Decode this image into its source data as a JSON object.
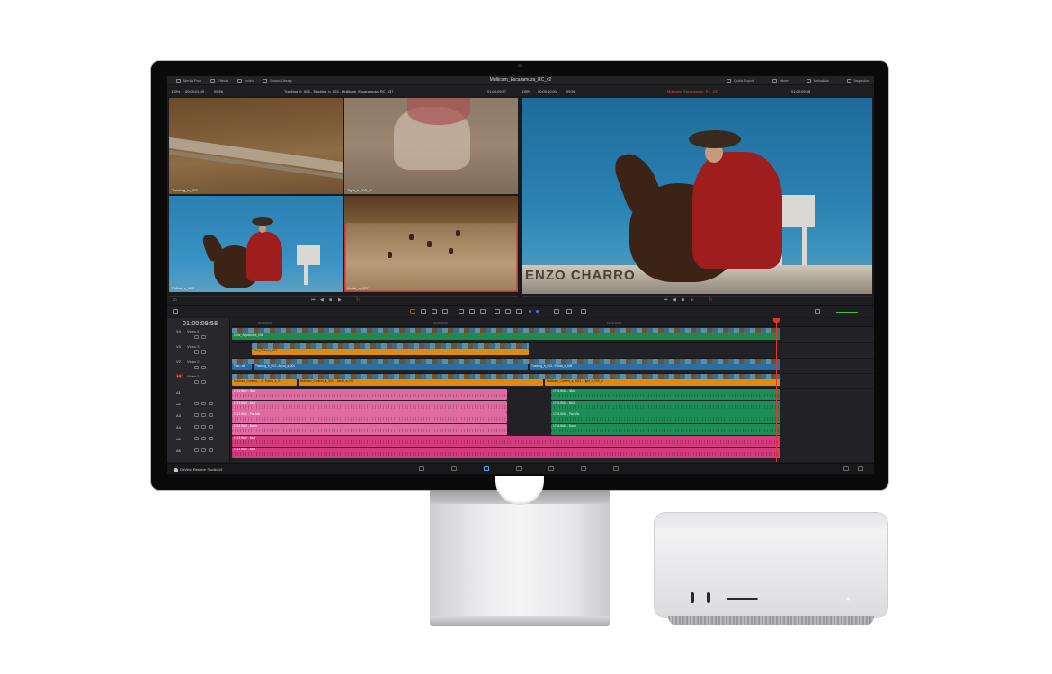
{
  "app": {
    "title": "Multicam_Escaramuza_RC_v2",
    "brand": "DaVinci Resolve Studio 19"
  },
  "toolbar": {
    "left": [
      "Media Pool",
      "Effects",
      "Index",
      "Sound Library"
    ],
    "right": [
      "Quick Export",
      "Mixer",
      "Metadata",
      "Inspector"
    ]
  },
  "source_viewer": {
    "zoom": "135%",
    "timecode_left": "00:00:01:49",
    "duration": "09:56",
    "clip_name": "Tracking_b_003 - Tracking_b_003 - Multicam_Escaramuza_RC_037",
    "timecode_right": "01:00:09:57"
  },
  "program_viewer": {
    "zoom": "135%",
    "timecode_left": "00:00:10:01",
    "duration": "09:56",
    "record_name": "Multicam_Escaramuza_RC_037",
    "timecode_right": "01:00:09:58"
  },
  "multicam": {
    "angles": [
      {
        "label": "Tracking_b_003"
      },
      {
        "label": "Tight_b_005_al"
      },
      {
        "label": "Follow_c_008"
      },
      {
        "label": "Aerial_a_007"
      }
    ],
    "active_angle": "Aerial_a_007"
  },
  "program": {
    "sign_text": "ENZO CHARRO"
  },
  "timeline": {
    "timecode": "01:00:09:58",
    "ruler": [
      "01:00:00:00",
      "01:00:05:00",
      "01:00:10:00"
    ],
    "tracks": [
      {
        "id": "V4",
        "name": "Video 4"
      },
      {
        "id": "V3",
        "name": "Video 3"
      },
      {
        "id": "V2",
        "name": "Video 2"
      },
      {
        "id": "V1",
        "name": "Video 1"
      },
      {
        "id": "A1",
        "name": ""
      },
      {
        "id": "A2",
        "name": ""
      },
      {
        "id": "A3",
        "name": ""
      },
      {
        "id": "A4",
        "name": ""
      },
      {
        "id": "A5",
        "name": ""
      },
      {
        "id": "A6",
        "name": ""
      }
    ],
    "clips": {
      "adjustment": "Color_Adjustment_004",
      "text": "Text_Refresh_009",
      "v1_a": "Trac...all",
      "v1_b": "Tracking_b_003 - Aerial_a_001",
      "v1_c": "Tracking_b_003 - Follow_c_008",
      "mc_a": "Multicam_Content_...1 - Follow_c_0...",
      "mc_b": "Multicam_Content_a_0023 - Aerial_a_007",
      "mc_c": "Multicam_Content_a_0023 - Tight_b_005_al",
      "a1_l": "1713 WAV - 36al",
      "a1_r": "1718.WAV - 36AL",
      "a2_l": "1713 WAV - Mult",
      "a2_r": "1718.WAV - Mult",
      "a3_l": "1713 WAV - Pan Mic",
      "a3_r": "1718.WAV - Pad Mic",
      "a4_l": "1713 WAV - Boom",
      "a4_r": "1718.WAV - Boom",
      "a5": "1713 WAV - Mult",
      "a6": "1713 WAV - Mult"
    }
  },
  "colors": {
    "accent_red": "#d6302a",
    "clip_green": "#1f8a4a",
    "clip_orange": "#e08a16",
    "clip_blue": "#2a6ea6",
    "clip_pink": "#e06aa2",
    "clip_magenta": "#d63b7f"
  }
}
